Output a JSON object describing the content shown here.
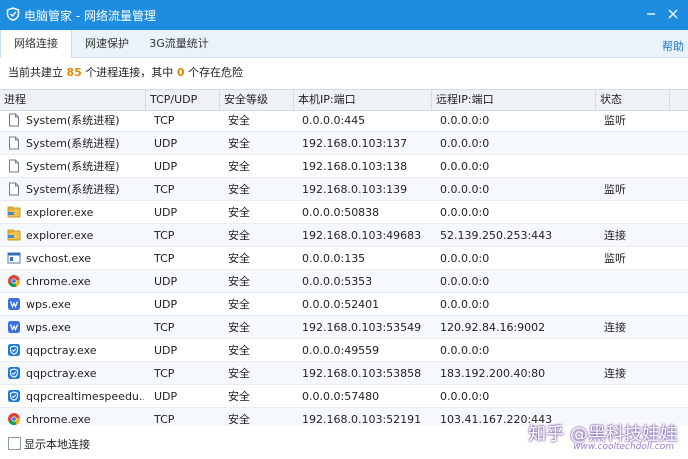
{
  "window": {
    "title": "电脑管家 - 网络流量管理",
    "help": "帮助"
  },
  "tabs": [
    {
      "label": "网络连接"
    },
    {
      "label": "网速保护"
    },
    {
      "label": "3G流量统计"
    }
  ],
  "summary": {
    "prefix": "当前共建立",
    "process_count": "85",
    "middle": "个进程连接，其中",
    "danger_count": "0",
    "suffix": "个存在危险"
  },
  "columns": [
    "进程",
    "TCP/UDP",
    "安全等级",
    "本机IP:端口",
    "远程IP:端口",
    "状态"
  ],
  "rows": [
    {
      "icon": "document-icon",
      "process": "System(系统进程)",
      "proto": "TCP",
      "level": "安全",
      "local": "0.0.0.0:445",
      "remote": "0.0.0.0:0",
      "status": "监听"
    },
    {
      "icon": "document-icon",
      "process": "System(系统进程)",
      "proto": "UDP",
      "level": "安全",
      "local": "192.168.0.103:137",
      "remote": "0.0.0.0:0",
      "status": ""
    },
    {
      "icon": "document-icon",
      "process": "System(系统进程)",
      "proto": "UDP",
      "level": "安全",
      "local": "192.168.0.103:138",
      "remote": "0.0.0.0:0",
      "status": ""
    },
    {
      "icon": "document-icon",
      "process": "System(系统进程)",
      "proto": "TCP",
      "level": "安全",
      "local": "192.168.0.103:139",
      "remote": "0.0.0.0:0",
      "status": "监听"
    },
    {
      "icon": "folder-icon",
      "process": "explorer.exe",
      "proto": "UDP",
      "level": "安全",
      "local": "0.0.0.0:50838",
      "remote": "0.0.0.0:0",
      "status": ""
    },
    {
      "icon": "folder-icon",
      "process": "explorer.exe",
      "proto": "TCP",
      "level": "安全",
      "local": "192.168.0.103:49683",
      "remote": "52.139.250.253:443",
      "status": "连接"
    },
    {
      "icon": "service-icon",
      "process": "svchost.exe",
      "proto": "TCP",
      "level": "安全",
      "local": "0.0.0.0:135",
      "remote": "0.0.0.0:0",
      "status": "监听"
    },
    {
      "icon": "chrome-icon",
      "process": "chrome.exe",
      "proto": "UDP",
      "level": "安全",
      "local": "0.0.0.0:5353",
      "remote": "0.0.0.0:0",
      "status": ""
    },
    {
      "icon": "wps-icon",
      "process": "wps.exe",
      "proto": "UDP",
      "level": "安全",
      "local": "0.0.0.0:52401",
      "remote": "0.0.0.0:0",
      "status": ""
    },
    {
      "icon": "wps-icon",
      "process": "wps.exe",
      "proto": "TCP",
      "level": "安全",
      "local": "192.168.0.103:53549",
      "remote": "120.92.84.16:9002",
      "status": "连接"
    },
    {
      "icon": "shield-icon",
      "process": "qqpctray.exe",
      "proto": "UDP",
      "level": "安全",
      "local": "0.0.0.0:49559",
      "remote": "0.0.0.0:0",
      "status": ""
    },
    {
      "icon": "shield-icon",
      "process": "qqpctray.exe",
      "proto": "TCP",
      "level": "安全",
      "local": "192.168.0.103:53858",
      "remote": "183.192.200.40:80",
      "status": "连接"
    },
    {
      "icon": "shield-icon",
      "process": "qqpcrealtimespeedu...",
      "proto": "UDP",
      "level": "安全",
      "local": "0.0.0.0:57480",
      "remote": "0.0.0.0:0",
      "status": ""
    },
    {
      "icon": "chrome-icon",
      "process": "chrome.exe",
      "proto": "TCP",
      "level": "安全",
      "local": "192.168.0.103:52191",
      "remote": "103.41.167.220:443",
      "status": ""
    }
  ],
  "footer": {
    "show_local_label": "显示本地连接",
    "watermark": "知乎 @黑科技娃娃",
    "watermark_url": "www.cooltechdoll.com"
  },
  "colors": {
    "titlebar": "#1e8de0",
    "accent_count": "#e0890a",
    "link": "#1e73c8"
  }
}
